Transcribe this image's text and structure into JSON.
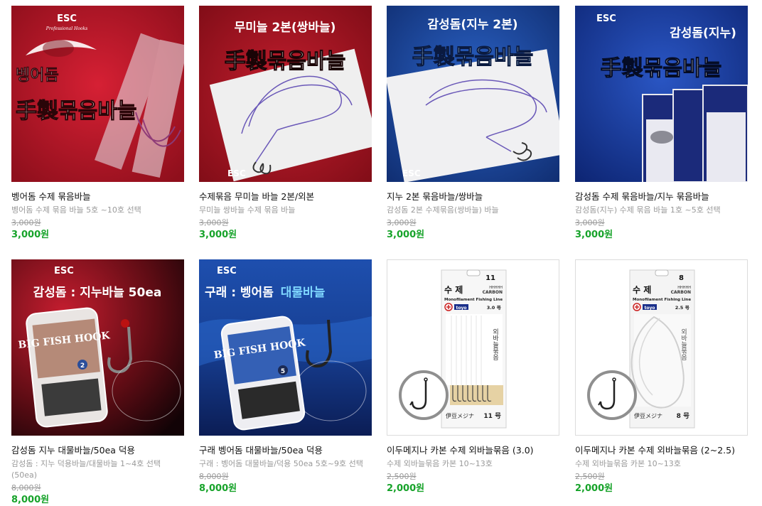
{
  "products": [
    {
      "name": "벵어돔 수제 묶음바늘",
      "desc": "벵어돔 수제 묶음 바늘 5호 ~10호 선택",
      "orig_price": "3,000원",
      "sale_price": "3,000원",
      "img": {
        "logo": "ESC",
        "logo_sub": "Professional Hooks",
        "top": "벵어돔",
        "big": "手製묶음바늘",
        "bg": "#c8182a"
      }
    },
    {
      "name": "수제묶음 무미늘 바늘 2본/외본",
      "desc": "무미늘 쌍바늘 수제 묶음 바늘",
      "orig_price": "3,000원",
      "sale_price": "3,000원",
      "img": {
        "logo": "ESC",
        "top": "무미늘 2본(쌍바늘)",
        "big": "手製묶음바늘",
        "bg": "#b51826"
      }
    },
    {
      "name": "지누 2본 묶음바늘/쌍바늘",
      "desc": "감성돔 2본 수제묶음(쌍바늘) 바늘",
      "orig_price": "3,000원",
      "sale_price": "3,000원",
      "img": {
        "logo": "ESC",
        "top": "감성돔(지누 2본)",
        "big": "手製묶음바늘",
        "bg": "#1e4a9e"
      }
    },
    {
      "name": "감성돔 수제 묶음바늘/지누 묶음바늘",
      "desc": "감성돔(지누) 수제 묶음 바늘 1호 ~5호 선택",
      "orig_price": "3,000원",
      "sale_price": "3,000원",
      "img": {
        "logo": "ESC",
        "top": "감성돔(지누)",
        "big": "手製묶음바늘",
        "bg": "#1a3d98"
      }
    },
    {
      "name": "감성돔 지누 대물바늘/50ea 덕용",
      "desc": "감성돔 : 지누 덕용바늘/대물바늘 1~4호 선택(50ea)",
      "orig_price": "8,000원",
      "sale_price": "8,000원",
      "img": {
        "logo": "ESC",
        "top": "감성돔 : 지누바늘 50ea",
        "box": "BIG FISH HOOK",
        "box_no": "2",
        "bg": "#b3182a"
      }
    },
    {
      "name": "구래 벵어돔 대물바늘/50ea 덕용",
      "desc": "구래 : 벵어돔 대물바늘/덕용 50ea 5호~9호 선택",
      "orig_price": "8,000원",
      "sale_price": "8,000원",
      "img": {
        "logo": "ESC",
        "top": "구래 : 벵어돔",
        "top_hl": "대물바늘",
        "box": "BIG FISH HOOK",
        "box_no": "5",
        "bg": "#1c4aa3"
      }
    },
    {
      "name": "이두메지나 카본 수제 외바늘묶음 (3.0)",
      "desc": "수제 외바늘묶음 카본 10~13호",
      "orig_price": "2,500원",
      "sale_price": "2,000원",
      "img": {
        "num": "11",
        "label": "수 제",
        "hh": "HHHHH",
        "carbon": "CARBON",
        "line": "Monofilament Fishing Line",
        "brand": "toyo",
        "size": "3.0 号",
        "vert": "외바늘묶음",
        "foot": "伊豆メジナ",
        "foot_no": "11 号"
      }
    },
    {
      "name": "이두메지나 카본 수제 외바늘묶음 (2~2.5)",
      "desc": "수제 외바늘묶음 카본 10~13호",
      "orig_price": "2,500원",
      "sale_price": "2,000원",
      "img": {
        "num": "8",
        "label": "수 제",
        "hh": "HHHHH",
        "carbon": "CARBON",
        "line": "Monofilament Fishing Line",
        "brand": "toyo",
        "size": "2.5 号",
        "vert": "외바늘묶음",
        "foot": "伊豆メジナ",
        "foot_no": "8 号"
      }
    }
  ]
}
